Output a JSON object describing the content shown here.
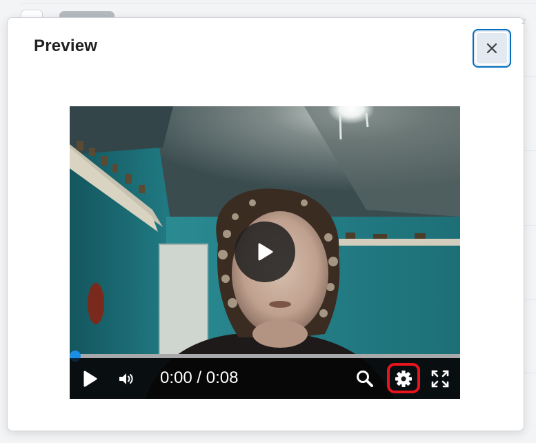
{
  "dialog": {
    "title": "Preview",
    "close_label": "Close"
  },
  "player": {
    "current_time": "0:00",
    "separator": "/",
    "duration": "0:08",
    "progress": 0,
    "accent_color": "#1a8fe3",
    "highlight_color": "#e8141e",
    "icons": [
      "play-icon",
      "volume-icon",
      "search-icon",
      "gear-icon",
      "fullscreen-icon",
      "big-play-icon"
    ]
  }
}
